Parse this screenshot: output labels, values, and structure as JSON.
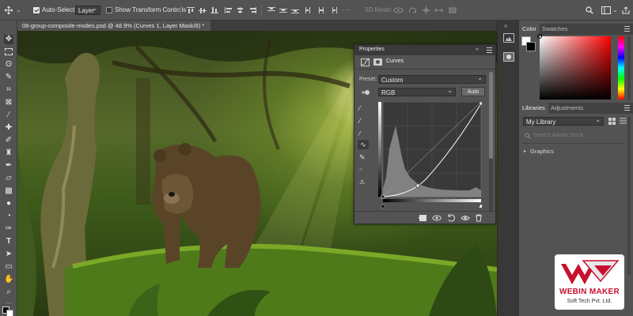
{
  "options_bar": {
    "auto_select_label": "Auto-Select:",
    "auto_select_checked": true,
    "auto_select_target": "Layer",
    "show_transform_label": "Show Transform Controls",
    "show_transform_checked": false,
    "mode_3d_label": "3D Mode:"
  },
  "document": {
    "tab_title": "08-group-composite-modes.psd @ 48.9% (Curves 1, Layer Mask/8) *"
  },
  "properties": {
    "panel_title": "Properties",
    "adjustment_name": "Curves",
    "preset_label": "Preset:",
    "preset_value": "Custom",
    "channel_value": "RGB",
    "auto_label": "Auto"
  },
  "color_panel": {
    "tabs": [
      "Color",
      "Swatches"
    ],
    "accent_hue": "#ff0000"
  },
  "libraries_panel": {
    "tabs": [
      "Libraries",
      "Adjustments"
    ],
    "library_value": "My Library",
    "search_placeholder": "Search Adobe Stock",
    "section_label": "Graphics"
  },
  "watermark": {
    "line1": "WEBIN MAKER",
    "line2": "Soft Tech Pvt. Ltd.",
    "brand_color": "#c8102e"
  },
  "icons": [
    "move-icon",
    "search-icon",
    "workspace-icon",
    "share-icon",
    "histogram-icon",
    "curves-icon"
  ]
}
